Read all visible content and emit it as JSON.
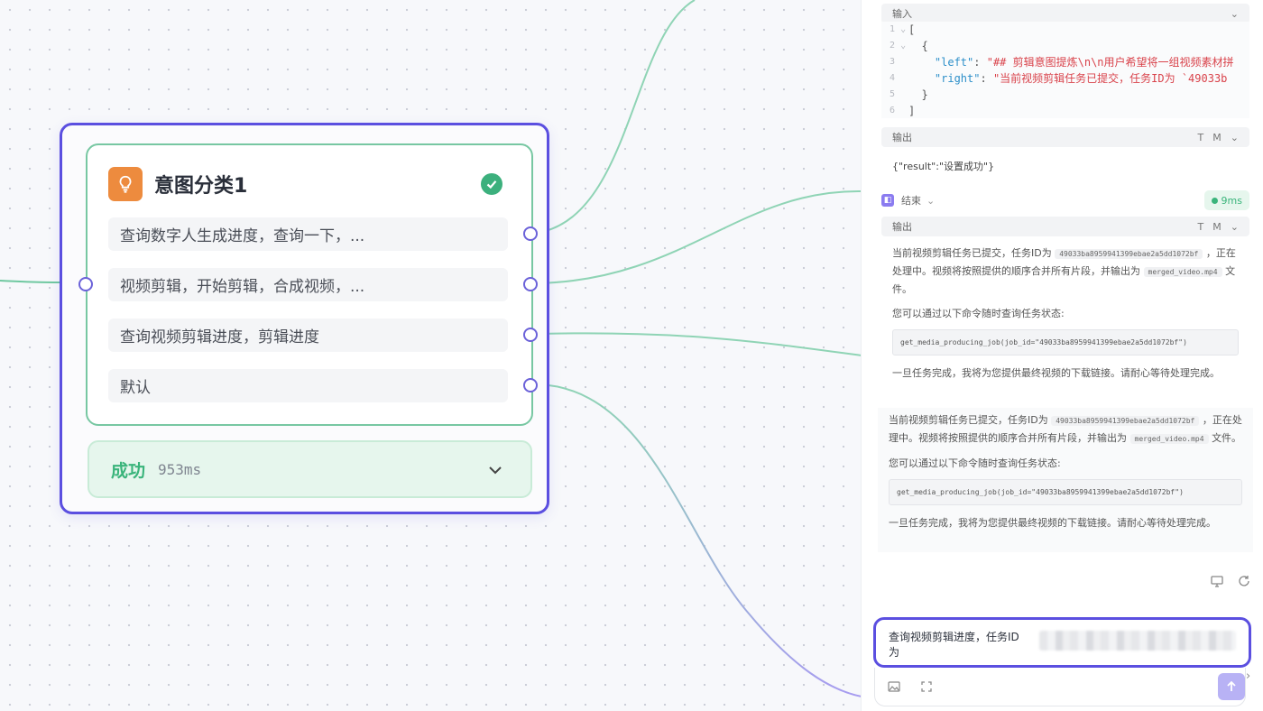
{
  "node": {
    "title": "意图分类1",
    "intents": [
      "查询数字人生成进度，查询一下，...",
      "视频剪辑，开始剪辑，合成视频，...",
      "查询视频剪辑进度，剪辑进度",
      "默认"
    ],
    "status_label": "成功",
    "status_time": "953ms",
    "icon": "lightbulb-icon",
    "accent": "#5b4fe0",
    "success_color": "#3ab47b"
  },
  "panel": {
    "input_section": {
      "label": "输入",
      "code_lines": [
        {
          "num": "1",
          "fold": "⌄",
          "text": "["
        },
        {
          "num": "2",
          "fold": "⌄",
          "text": "  {"
        },
        {
          "num": "3",
          "key": "\"left\"",
          "value": "\"## 剪辑意图提炼\\n\\n用户希望将一组视频素材拼"
        },
        {
          "num": "4",
          "key": "\"right\"",
          "value": "\"当前视频剪辑任务已提交，任务ID为 `49033b"
        },
        {
          "num": "5",
          "text": "  }"
        },
        {
          "num": "6",
          "text": "]"
        }
      ]
    },
    "output_section": {
      "label": "输出",
      "tools": [
        "T",
        "M"
      ],
      "value": "{\"result\":\"设置成功\"}"
    },
    "end_node": {
      "label": "结束",
      "badge": "9ms",
      "output_label": "输出",
      "tools": [
        "T",
        "M"
      ]
    },
    "message1": {
      "line1_a": "当前视频剪辑任务已提交，任务ID为",
      "job_id": "49033ba8959941399ebae2a5dd1072bf",
      "line1_b": "，正在处理中。视频将按照提供的顺序合并所有片段，并输出为",
      "filename": "merged_video.mp4",
      "line1_c": "文件。",
      "line2": "您可以通过以下命令随时查询任务状态:",
      "command": "get_media_producing_job(job_id=\"49033ba8959941399ebae2a5dd1072bf\")",
      "line3": "一旦任务完成，我将为您提供最终视频的下载链接。请耐心等待处理完成。"
    },
    "message2": {
      "line1_a": "当前视频剪辑任务已提交，任务ID为",
      "job_id": "49033ba8959941399ebae2a5dd1072bf",
      "line1_b": "，正在处理中。视频将按照提供的顺序合并所有片段，并输出为",
      "filename": "merged_video.mp4",
      "line1_c": "文件。",
      "line2": "您可以通过以下命令随时查询任务状态:",
      "command": "get_media_producing_job(job_id=\"49033ba8959941399ebae2a5dd1072bf\")",
      "line3": "一旦任务完成，我将为您提供最终视频的下载链接。请耐心等待处理完成。"
    },
    "chat_input": {
      "value": "查询视频剪辑进度，任务ID为"
    }
  }
}
